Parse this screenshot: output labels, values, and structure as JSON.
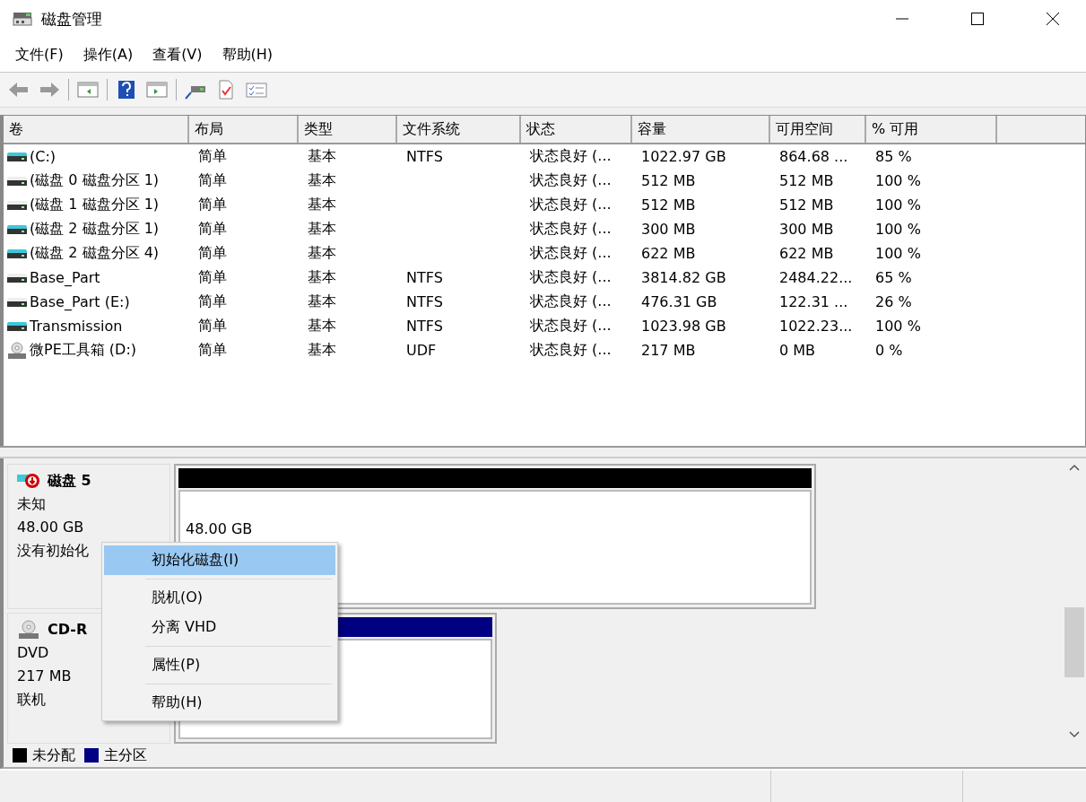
{
  "window": {
    "title": "磁盘管理"
  },
  "menu": [
    "文件(F)",
    "操作(A)",
    "查看(V)",
    "帮助(H)"
  ],
  "table": {
    "columns": [
      "卷",
      "布局",
      "类型",
      "文件系统",
      "状态",
      "容量",
      "可用空间",
      "% 可用"
    ],
    "rows": [
      {
        "kind": "colored",
        "cells": [
          " (C:)",
          "简单",
          "基本",
          "NTFS",
          "状态良好 (...",
          "1022.97 GB",
          "864.68 ...",
          "85 %"
        ]
      },
      {
        "kind": "plain",
        "cells": [
          "(磁盘 0 磁盘分区 1)",
          "简单",
          "基本",
          "",
          "状态良好 (...",
          "512 MB",
          "512 MB",
          "100 %"
        ]
      },
      {
        "kind": "plain",
        "cells": [
          "(磁盘 1 磁盘分区 1)",
          "简单",
          "基本",
          "",
          "状态良好 (...",
          "512 MB",
          "512 MB",
          "100 %"
        ]
      },
      {
        "kind": "colored",
        "cells": [
          "(磁盘 2 磁盘分区 1)",
          "简单",
          "基本",
          "",
          "状态良好 (...",
          "300 MB",
          "300 MB",
          "100 %"
        ]
      },
      {
        "kind": "colored",
        "cells": [
          "(磁盘 2 磁盘分区 4)",
          "简单",
          "基本",
          "",
          "状态良好 (...",
          "622 MB",
          "622 MB",
          "100 %"
        ]
      },
      {
        "kind": "plain",
        "cells": [
          "Base_Part",
          "简单",
          "基本",
          "NTFS",
          "状态良好 (...",
          "3814.82 GB",
          "2484.22...",
          "65 %"
        ]
      },
      {
        "kind": "plain",
        "cells": [
          "Base_Part (E:)",
          "简单",
          "基本",
          "NTFS",
          "状态良好 (...",
          "476.31 GB",
          "122.31 ...",
          "26 %"
        ]
      },
      {
        "kind": "colored",
        "cells": [
          "Transmission",
          "简单",
          "基本",
          "NTFS",
          "状态良好 (...",
          "1023.98 GB",
          "1022.23...",
          "100 %"
        ]
      },
      {
        "kind": "disc",
        "cells": [
          "微PE工具箱 (D:)",
          "简单",
          "基本",
          "UDF",
          "状态良好 (...",
          "217 MB",
          "0 MB",
          "0 %"
        ]
      }
    ]
  },
  "disks": [
    {
      "kind": "disk_error",
      "name": "磁盘 5",
      "lines": [
        "未知",
        "48.00 GB",
        "没有初始化"
      ],
      "partition": {
        "kind": "unallocated",
        "size": "48.00 GB"
      }
    },
    {
      "kind": "disc",
      "name": "CD-R",
      "lines": [
        "DVD",
        "217 MB",
        "联机"
      ],
      "partition": {
        "kind": "primary"
      }
    }
  ],
  "legend": [
    {
      "label": "未分配",
      "color": "#000000"
    },
    {
      "label": "主分区",
      "color": "#000080"
    }
  ],
  "context_menu": {
    "groups": [
      [
        {
          "label": "初始化磁盘(I)",
          "selected": true
        }
      ],
      [
        {
          "label": "脱机(O)",
          "selected": false
        },
        {
          "label": "分离 VHD",
          "selected": false
        }
      ],
      [
        {
          "label": "属性(P)",
          "selected": false
        }
      ],
      [
        {
          "label": "帮助(H)",
          "selected": false
        }
      ]
    ]
  }
}
